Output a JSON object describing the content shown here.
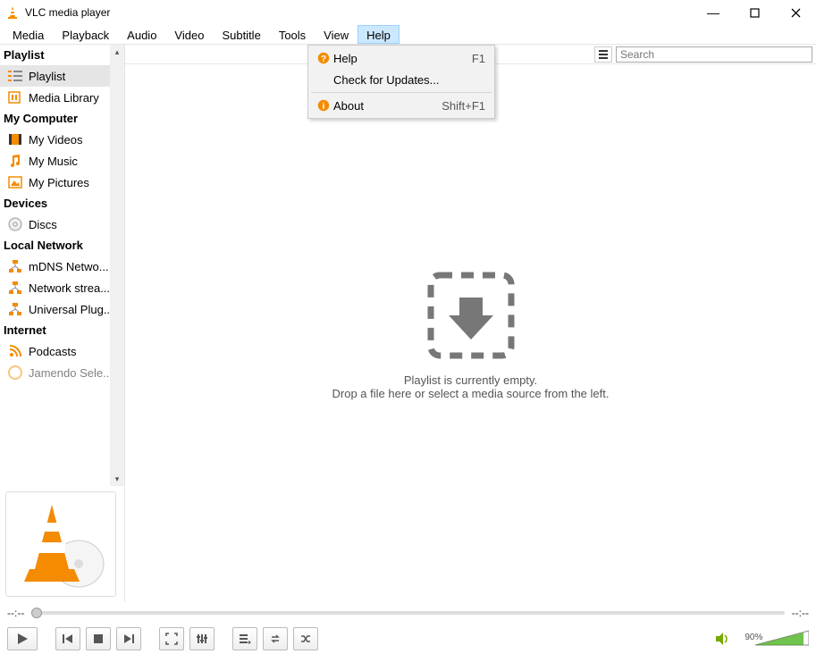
{
  "window": {
    "title": "VLC media player"
  },
  "menubar": [
    "Media",
    "Playback",
    "Audio",
    "Video",
    "Subtitle",
    "Tools",
    "View",
    "Help"
  ],
  "menubar_active": "Help",
  "help_menu": {
    "help_label": "Help",
    "help_accel": "F1",
    "updates_label": "Check for Updates...",
    "about_label": "About",
    "about_accel": "Shift+F1"
  },
  "sidebar": {
    "playlist_header": "Playlist",
    "group1": [
      {
        "id": "playlist",
        "label": "Playlist",
        "selected": true
      },
      {
        "id": "media-library",
        "label": "Media Library"
      }
    ],
    "my_computer_header": "My Computer",
    "group2": [
      {
        "id": "my-videos",
        "label": "My Videos"
      },
      {
        "id": "my-music",
        "label": "My Music"
      },
      {
        "id": "my-pictures",
        "label": "My Pictures"
      }
    ],
    "devices_header": "Devices",
    "group3": [
      {
        "id": "discs",
        "label": "Discs"
      }
    ],
    "local_network_header": "Local Network",
    "group4": [
      {
        "id": "mdns",
        "label": "mDNS Netwo..."
      },
      {
        "id": "netstream",
        "label": "Network strea..."
      },
      {
        "id": "upnp",
        "label": "Universal Plug..."
      }
    ],
    "internet_header": "Internet",
    "group5": [
      {
        "id": "podcasts",
        "label": "Podcasts"
      },
      {
        "id": "jamendo",
        "label": "Jamendo Sele..."
      }
    ]
  },
  "search": {
    "placeholder": "Search"
  },
  "empty": {
    "line1": "Playlist is currently empty.",
    "line2": "Drop a file here or select a media source from the left."
  },
  "time": {
    "elapsed": "--:--",
    "total": "--:--"
  },
  "volume": {
    "percent": "90%"
  }
}
